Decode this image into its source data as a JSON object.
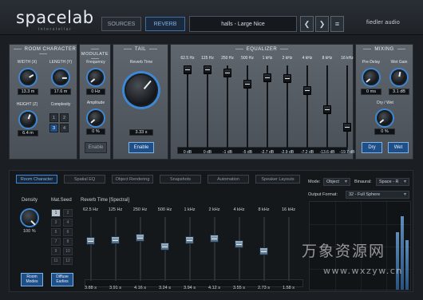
{
  "header": {
    "logo": "spacelab",
    "logo_sub": "interstellar",
    "sources_label": "SOURCES",
    "reverb_label": "REVERB",
    "preset_name": "halls - Large Nice",
    "prev_glyph": "❮",
    "next_glyph": "❯",
    "menu_glyph": "≡",
    "brand": "fiedler audio"
  },
  "room": {
    "title": "ROOM CHARACTER",
    "width_label": "WIDTH (X)",
    "width_value": "13.3 m",
    "length_label": "LENGTH (Y)",
    "length_value": "17.6 m",
    "height_label": "HEIGHT (Z)",
    "height_value": "6.4 m",
    "complexity_label": "Complexity",
    "complexity_options": [
      "1",
      "2",
      "3",
      "4"
    ],
    "complexity_selected": "3"
  },
  "modulate": {
    "title": "MODULATE",
    "frequency_label": "Frequency",
    "frequency_value": "0 Hz",
    "amplitude_label": "Amplitude",
    "amplitude_value": "0 %",
    "enable_label": "Enable"
  },
  "tail": {
    "title": "TAIL",
    "reverb_time_label": "Reverb Time",
    "reverb_time_value": "3.33 s",
    "enable_label": "Enable"
  },
  "equalizer": {
    "title": "EQUALIZER",
    "bands": [
      {
        "freq": "62.5 Hz",
        "gain_db": 0,
        "value": "0 dB"
      },
      {
        "freq": "125 Hz",
        "gain_db": 0,
        "value": "0 dB"
      },
      {
        "freq": "250 Hz",
        "gain_db": -1,
        "value": "-1 dB"
      },
      {
        "freq": "500 Hz",
        "gain_db": -5,
        "value": "-5 dB"
      },
      {
        "freq": "1 kHz",
        "gain_db": -2.7,
        "value": "-2.7 dB"
      },
      {
        "freq": "2 kHz",
        "gain_db": -2.9,
        "value": "-2.9 dB"
      },
      {
        "freq": "4 kHz",
        "gain_db": -7.2,
        "value": "-7.2 dB"
      },
      {
        "freq": "8 kHz",
        "gain_db": -13.6,
        "value": "-13.6 dB"
      },
      {
        "freq": "16 kHz",
        "gain_db": -19.7,
        "value": "-19.7 dB"
      }
    ]
  },
  "mixing": {
    "title": "MIXING",
    "predelay_label": "Pre-Delay",
    "predelay_value": "0 ms",
    "wetgain_label": "Wet Gain",
    "wetgain_value": "3.1 dB",
    "drywet_label": "Dry / Wet",
    "drywet_value": "0 %",
    "dry_label": "Dry",
    "wet_label": "Wet"
  },
  "lower": {
    "tabs": [
      "Room Character",
      "Spatial EQ",
      "Object Rendering",
      "Snapshots",
      "Automation",
      "Speaker Layouts"
    ],
    "active_tab": "Room Character",
    "density_label": "Density",
    "density_value": "100 %",
    "matseed_label": "Mat.Seed",
    "seeds": [
      "1",
      "2",
      "3",
      "4",
      "5",
      "6",
      "7",
      "8",
      "9",
      "10",
      "11",
      "12"
    ],
    "seed_selected": "1",
    "reverb_time_title": "Reverb Time [Spectral]",
    "rt_bands": [
      {
        "freq": "62.5 Hz",
        "value": "3.88 s"
      },
      {
        "freq": "125 Hz",
        "value": "3.91 s"
      },
      {
        "freq": "250 Hz",
        "value": "4.16 s"
      },
      {
        "freq": "500 Hz",
        "value": "3.24 s"
      },
      {
        "freq": "1 kHz",
        "value": "3.94 s"
      },
      {
        "freq": "2 kHz",
        "value": "4.12 s"
      },
      {
        "freq": "4 kHz",
        "value": "3.55 s"
      },
      {
        "freq": "8 kHz",
        "value": "2.73 s"
      },
      {
        "freq": "16 kHz",
        "value": "1.58 s"
      }
    ],
    "room_modes_label": "Room Modes",
    "diffuse_early_label": "Diffuse Earlies",
    "mode_label": "Mode:",
    "mode_value": "Object",
    "binaural_label": "Binaural:",
    "binaural_value": "Space - R",
    "output_format_label": "Output Format:",
    "output_format_value": "32 - Full Sphere"
  },
  "watermark": {
    "cn": "万象资源网",
    "url": "www.wxzyw.cn"
  },
  "colors": {
    "accent": "#3e87d4",
    "panel": "#555c63",
    "background": "#1b1e22"
  }
}
